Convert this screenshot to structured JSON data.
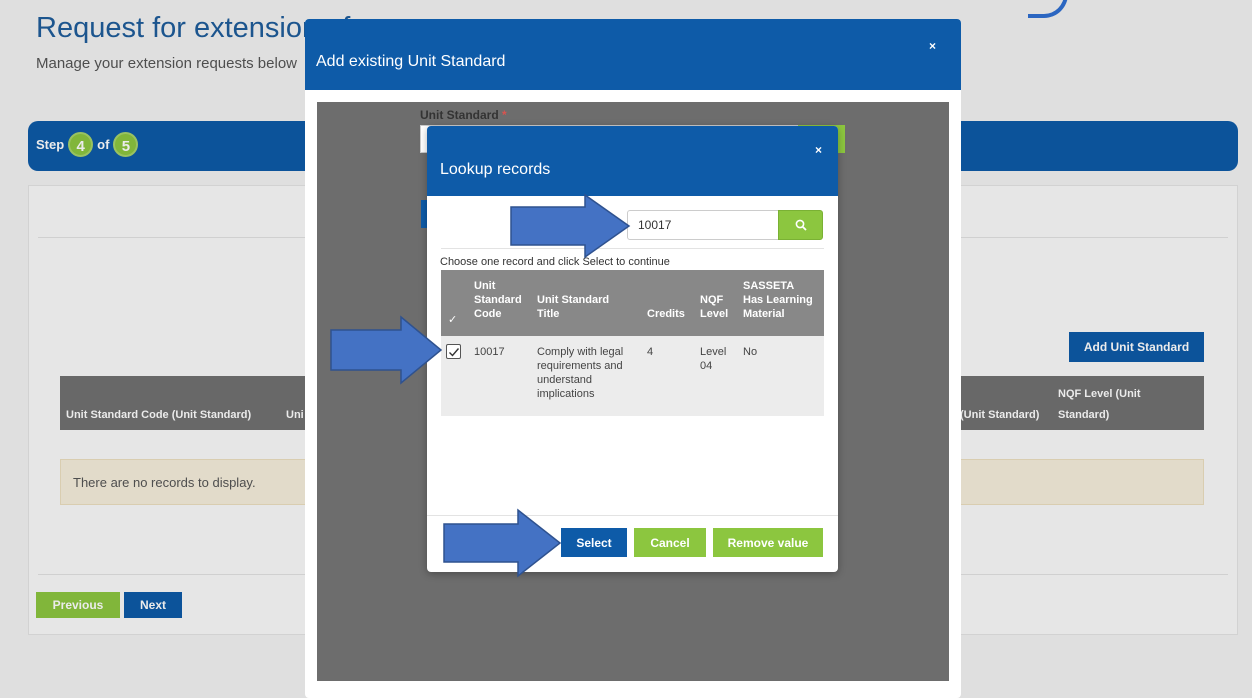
{
  "page": {
    "title": "Request for extension of",
    "subtitle": "Manage your extension requests below",
    "step": {
      "prefix": "Step",
      "current": "4",
      "of": "of",
      "total": "5"
    },
    "add_unit_standard_label": "Add Unit Standard",
    "grid_columns": [
      "Unit Standard Code (Unit Standard)",
      "Uni",
      "(Unit Standard)",
      "NQF Level (Unit",
      "Standard)"
    ],
    "no_records_text": "There are no records to display.",
    "previous_label": "Previous",
    "next_label": "Next"
  },
  "outer_modal": {
    "title": "Add existing Unit Standard",
    "close_label": "×",
    "field_label": "Unit Standard",
    "required_mark": "*"
  },
  "lookup_modal": {
    "title": "Lookup records",
    "close_label": "×",
    "search_value": "10017",
    "search_icon": "search-icon",
    "instruction": "Choose one record and click Select to continue",
    "columns": {
      "check": "✓",
      "code_1": "Unit",
      "code_2": "Standard",
      "code_3": "Code",
      "title_1": "Unit Standard",
      "title_2": "Title",
      "credits": "Credits",
      "nqf_1": "NQF",
      "nqf_2": "Level",
      "sas_1": "SASSETA",
      "sas_2": "Has Learning",
      "sas_3": "Material"
    },
    "rows": [
      {
        "selected": true,
        "code": "10017",
        "title_1": "Comply with legal",
        "title_2": "requirements and",
        "title_3": "understand",
        "title_4": "implications",
        "credits": "4",
        "nqf_1": "Level",
        "nqf_2": "04",
        "has_material": "No"
      }
    ],
    "buttons": {
      "select": "Select",
      "cancel": "Cancel",
      "remove": "Remove value"
    }
  },
  "colors": {
    "primary_blue": "#0e5ba8",
    "accent_green": "#8cc63f",
    "annotation_arrow": "#4472c4"
  }
}
